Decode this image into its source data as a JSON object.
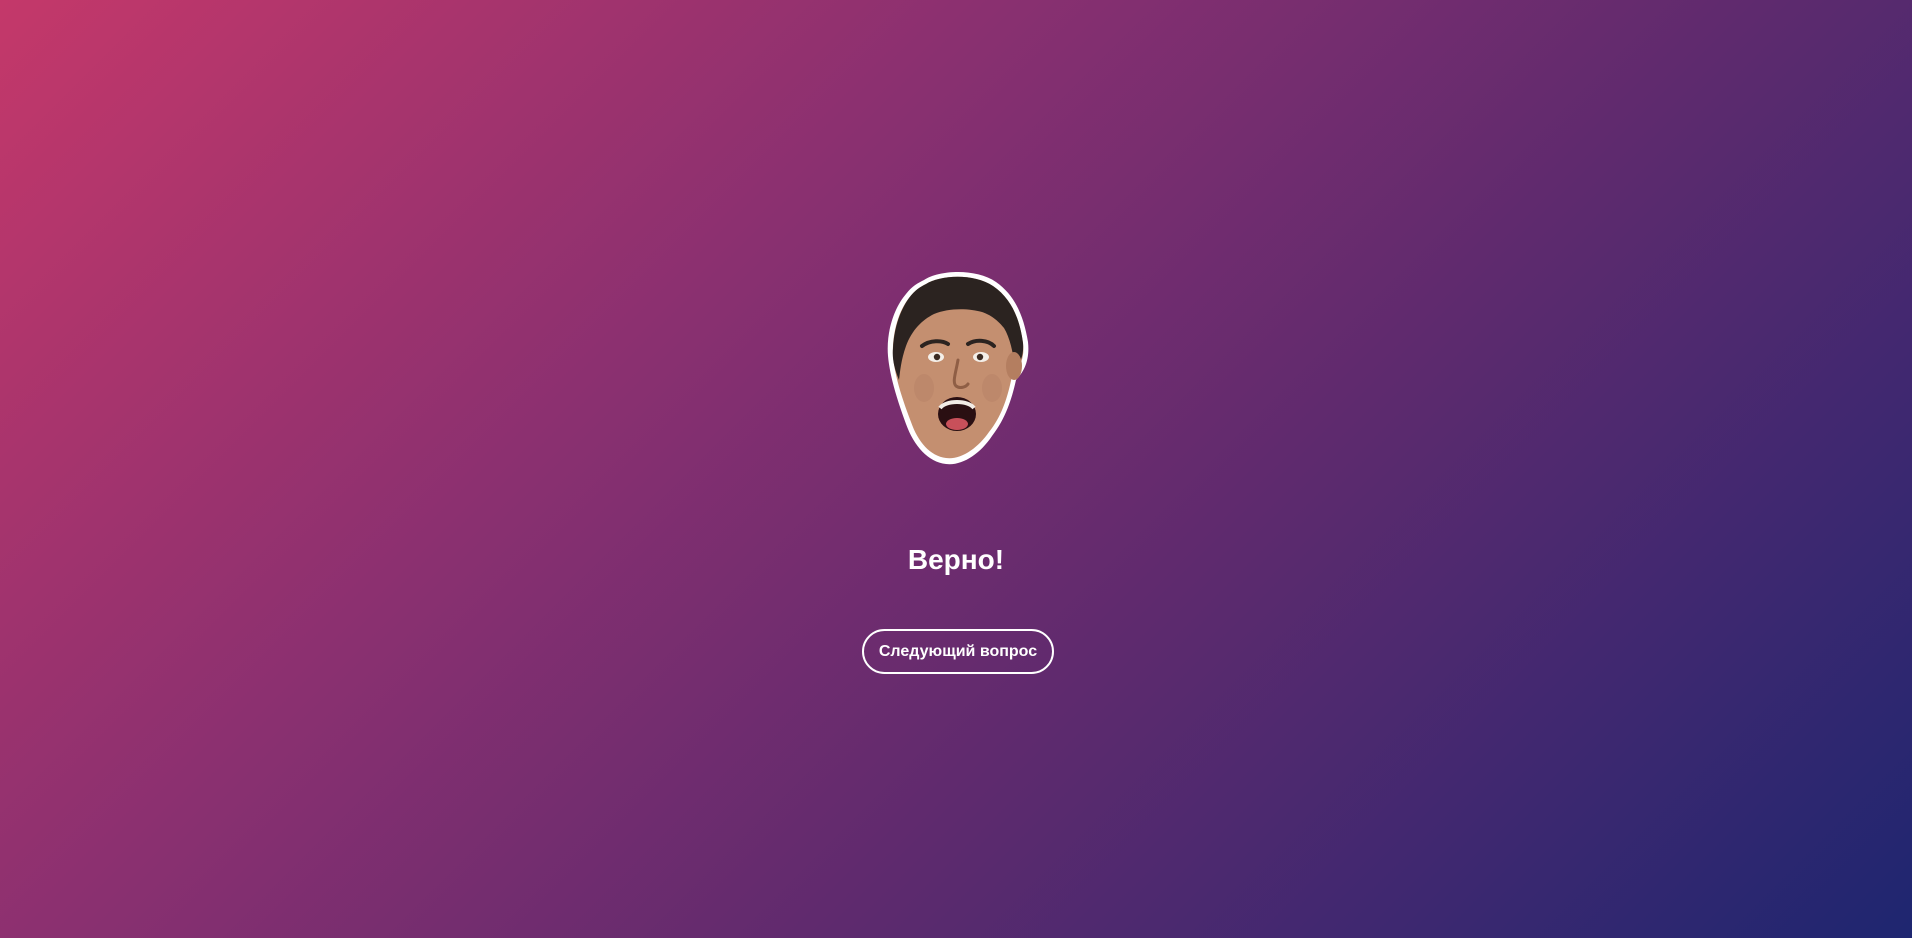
{
  "result": {
    "title": "Верно!",
    "image_icon": "surprised-face-sticker"
  },
  "actions": {
    "next_label": "Следующий вопрос"
  }
}
